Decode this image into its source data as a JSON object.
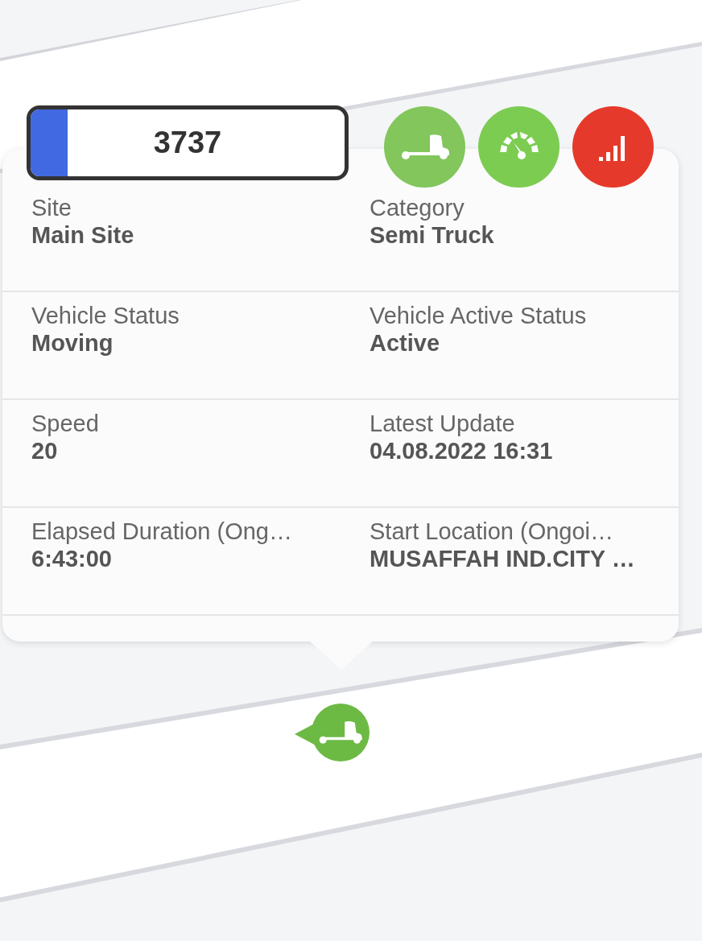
{
  "vehicle": {
    "plate": "3737"
  },
  "status_icons": [
    {
      "kind": "truck",
      "color": "#82c65c"
    },
    {
      "kind": "speed",
      "color": "#7ccc52"
    },
    {
      "kind": "signal",
      "color": "#e53a2b"
    }
  ],
  "fields": [
    {
      "label": "Site",
      "value": "Main Site"
    },
    {
      "label": "Category",
      "value": "Semi Truck"
    },
    {
      "label": "Vehicle Status",
      "value": "Moving"
    },
    {
      "label": "Vehicle Active Status",
      "value": "Active"
    },
    {
      "label": "Speed",
      "value": "20"
    },
    {
      "label": "Latest Update",
      "value": "04.08.2022 16:31"
    },
    {
      "label": "Elapsed Duration (Ong…",
      "value": "6:43:00"
    },
    {
      "label": "Start Location (Ongoi…",
      "value": "MUSAFFAH IND.CITY …"
    }
  ],
  "map_marker": {
    "kind": "truck",
    "color": "#6cb944"
  }
}
